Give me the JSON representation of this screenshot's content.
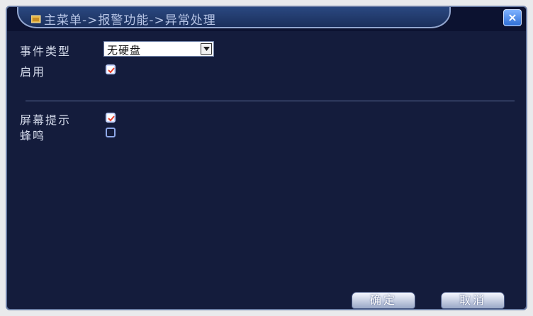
{
  "window": {
    "title": "主菜单->报警功能->异常处理",
    "close_glyph": "×"
  },
  "form": {
    "event_type": {
      "label": "事件类型",
      "value": "无硬盘"
    },
    "enable": {
      "label": "启用",
      "checked": true
    },
    "screen_tip": {
      "label": "屏幕提示",
      "checked": true
    },
    "buzzer": {
      "label": "蜂鸣",
      "checked": false
    }
  },
  "buttons": {
    "ok_label": "确定",
    "cancel_label": "取消"
  },
  "colors": {
    "background": "#141c3c",
    "title_tab": "#2a4880",
    "accent": "#8ea8e8",
    "check_mark": "#e8402e"
  },
  "icons": {
    "title": "folder-icon",
    "close": "close-icon",
    "dropdown": "chevron-down-icon"
  }
}
